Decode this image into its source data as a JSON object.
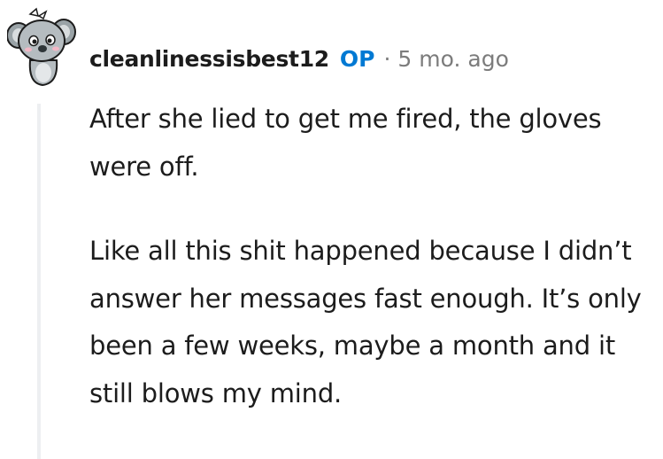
{
  "comment": {
    "author": "cleanlinessisbest12",
    "op_badge": "OP",
    "separator": "·",
    "timestamp": "5 mo. ago",
    "paragraphs": [
      "After she lied to get me fired, the gloves were off.",
      "Like all this shit happened because I didn’t answer her messages fast enough. It’s only been a few weeks, maybe a month and it still blows my mind."
    ]
  },
  "colors": {
    "op_badge": "#0079d3",
    "meta_text": "#7c7c7c",
    "body_text": "#1c1c1c",
    "thread_line": "#edeff1"
  },
  "icons": {
    "avatar": "koala-avatar-icon"
  }
}
